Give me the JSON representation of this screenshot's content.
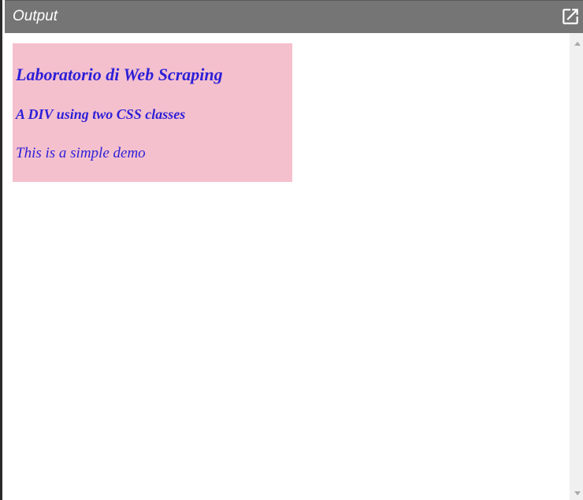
{
  "header": {
    "title": "Output",
    "popout_icon": "open-in-new-icon"
  },
  "demo": {
    "heading": "Laboratorio di Web Scraping",
    "subheading": "A DIV using two CSS classes",
    "paragraph": "This is a simple demo",
    "colors": {
      "background": "#f5c0cd",
      "text": "#2d1fd8"
    }
  },
  "colors": {
    "header_background": "#757575",
    "header_text": "#ffffff",
    "scrollbar_track": "#f0f0f0"
  }
}
